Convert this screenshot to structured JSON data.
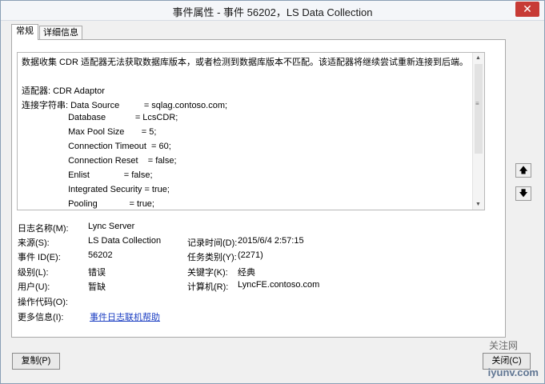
{
  "window": {
    "title": "事件属性 - 事件 56202，LS Data Collection",
    "close_label": "✕"
  },
  "tabs": [
    {
      "label": "常规"
    },
    {
      "label": "详细信息"
    }
  ],
  "description": {
    "lines": [
      "数据收集 CDR 适配器无法获取数据库版本，或者检测到数据库版本不匹配。该适配器将继续尝试重新连接到后端。",
      "",
      "适配器: CDR Adaptor",
      "连接字符串: Data Source          = sqlag.contoso.com;",
      "                   Database            = LcsCDR;",
      "                   Max Pool Size       = 5;",
      "                   Connection Timeout  = 60;",
      "                   Connection Reset    = false;",
      "                   Enlist              = false;",
      "                   Integrated Security = true;",
      "                   Pooling             = true;"
    ]
  },
  "fields": {
    "log_name_label": "日志名称(M):",
    "log_name": "Lync Server",
    "source_label": "来源(S):",
    "source": "LS Data Collection",
    "logged_label": "记录时间(D):",
    "logged": "2015/6/4 2:57:15",
    "event_id_label": "事件 ID(E):",
    "event_id": "56202",
    "task_label": "任务类别(Y):",
    "task": "(2271)",
    "level_label": "级别(L):",
    "level": "错误",
    "keywords_label": "关键字(K):",
    "keywords": "经典",
    "user_label": "用户(U):",
    "user": "暂缺",
    "computer_label": "计算机(R):",
    "computer": "LyncFE.contoso.com",
    "opcode_label": "操作代码(O):",
    "more_info_label": "更多信息(I):",
    "more_info_link": "事件日志联机帮助"
  },
  "buttons": {
    "copy": "复制(P)",
    "close": "关闭(C)"
  },
  "side_buttons": {
    "up": "🡅",
    "down": "🡇"
  },
  "watermark": {
    "text_small": "关注网",
    "text_big": "iyunv.com"
  }
}
